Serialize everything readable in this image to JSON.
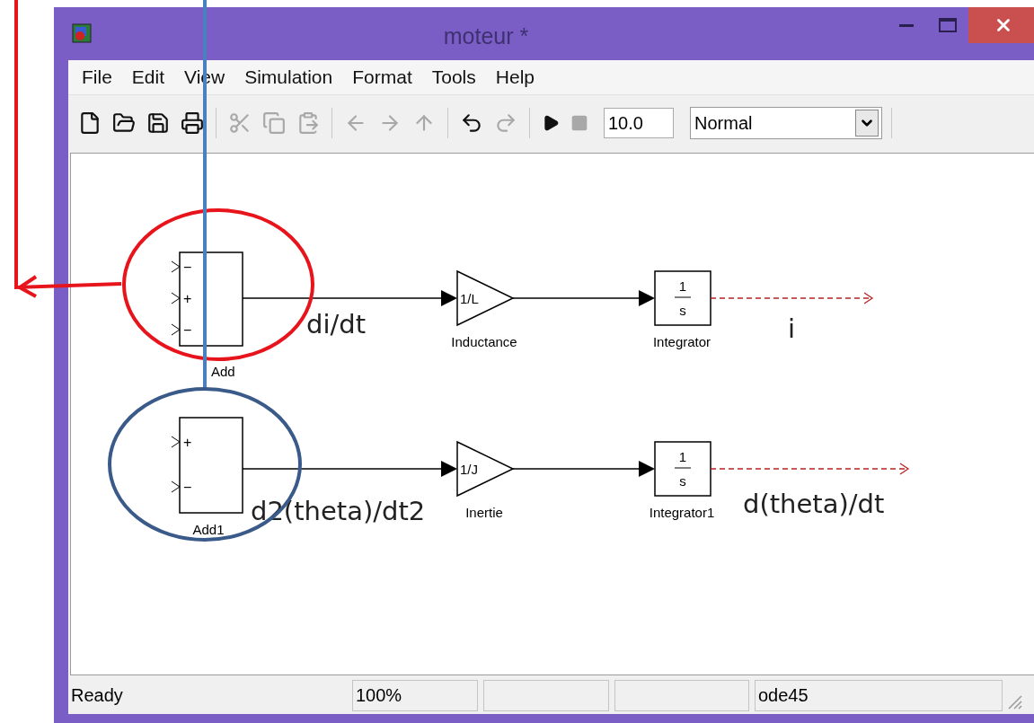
{
  "window": {
    "title": "moteur *"
  },
  "menu": [
    "File",
    "Edit",
    "View",
    "Simulation",
    "Format",
    "Tools",
    "Help"
  ],
  "toolbar": {
    "tools": [
      {
        "kind": "new",
        "disabled": false
      },
      {
        "kind": "open",
        "disabled": false
      },
      {
        "kind": "save",
        "disabled": false
      },
      {
        "kind": "print",
        "disabled": false
      },
      {
        "kind": "cut",
        "disabled": true
      },
      {
        "kind": "copy",
        "disabled": true
      },
      {
        "kind": "paste",
        "disabled": true
      },
      {
        "kind": "back",
        "disabled": true
      },
      {
        "kind": "forward",
        "disabled": true
      },
      {
        "kind": "up",
        "disabled": true
      },
      {
        "kind": "undo",
        "disabled": false
      },
      {
        "kind": "redo",
        "disabled": true
      },
      {
        "kind": "play",
        "disabled": false
      },
      {
        "kind": "stop",
        "disabled": true
      }
    ],
    "stop_time": "10.0",
    "mode": "Normal"
  },
  "diagram": {
    "rows": [
      {
        "sum": {
          "label": "Add",
          "signs": [
            "−",
            "+",
            "−"
          ]
        },
        "gain": {
          "text": "1/L",
          "label": "Inductance"
        },
        "integrator": {
          "numerator": "1",
          "denominator": "s",
          "label": "Integrator"
        },
        "sum_annotation": "di/dt",
        "output_annotation": "i"
      },
      {
        "sum": {
          "label": "Add1",
          "signs": [
            "+",
            "−"
          ]
        },
        "gain": {
          "text": "1/J",
          "label": "Inertie"
        },
        "integrator": {
          "numerator": "1",
          "denominator": "s",
          "label": "Integrator1"
        },
        "sum_annotation": "d2(theta)/dt2",
        "output_annotation": "d(theta)/dt"
      }
    ]
  },
  "status_bar": {
    "state": "Ready",
    "zoom": "100%",
    "solver": "ode45"
  }
}
